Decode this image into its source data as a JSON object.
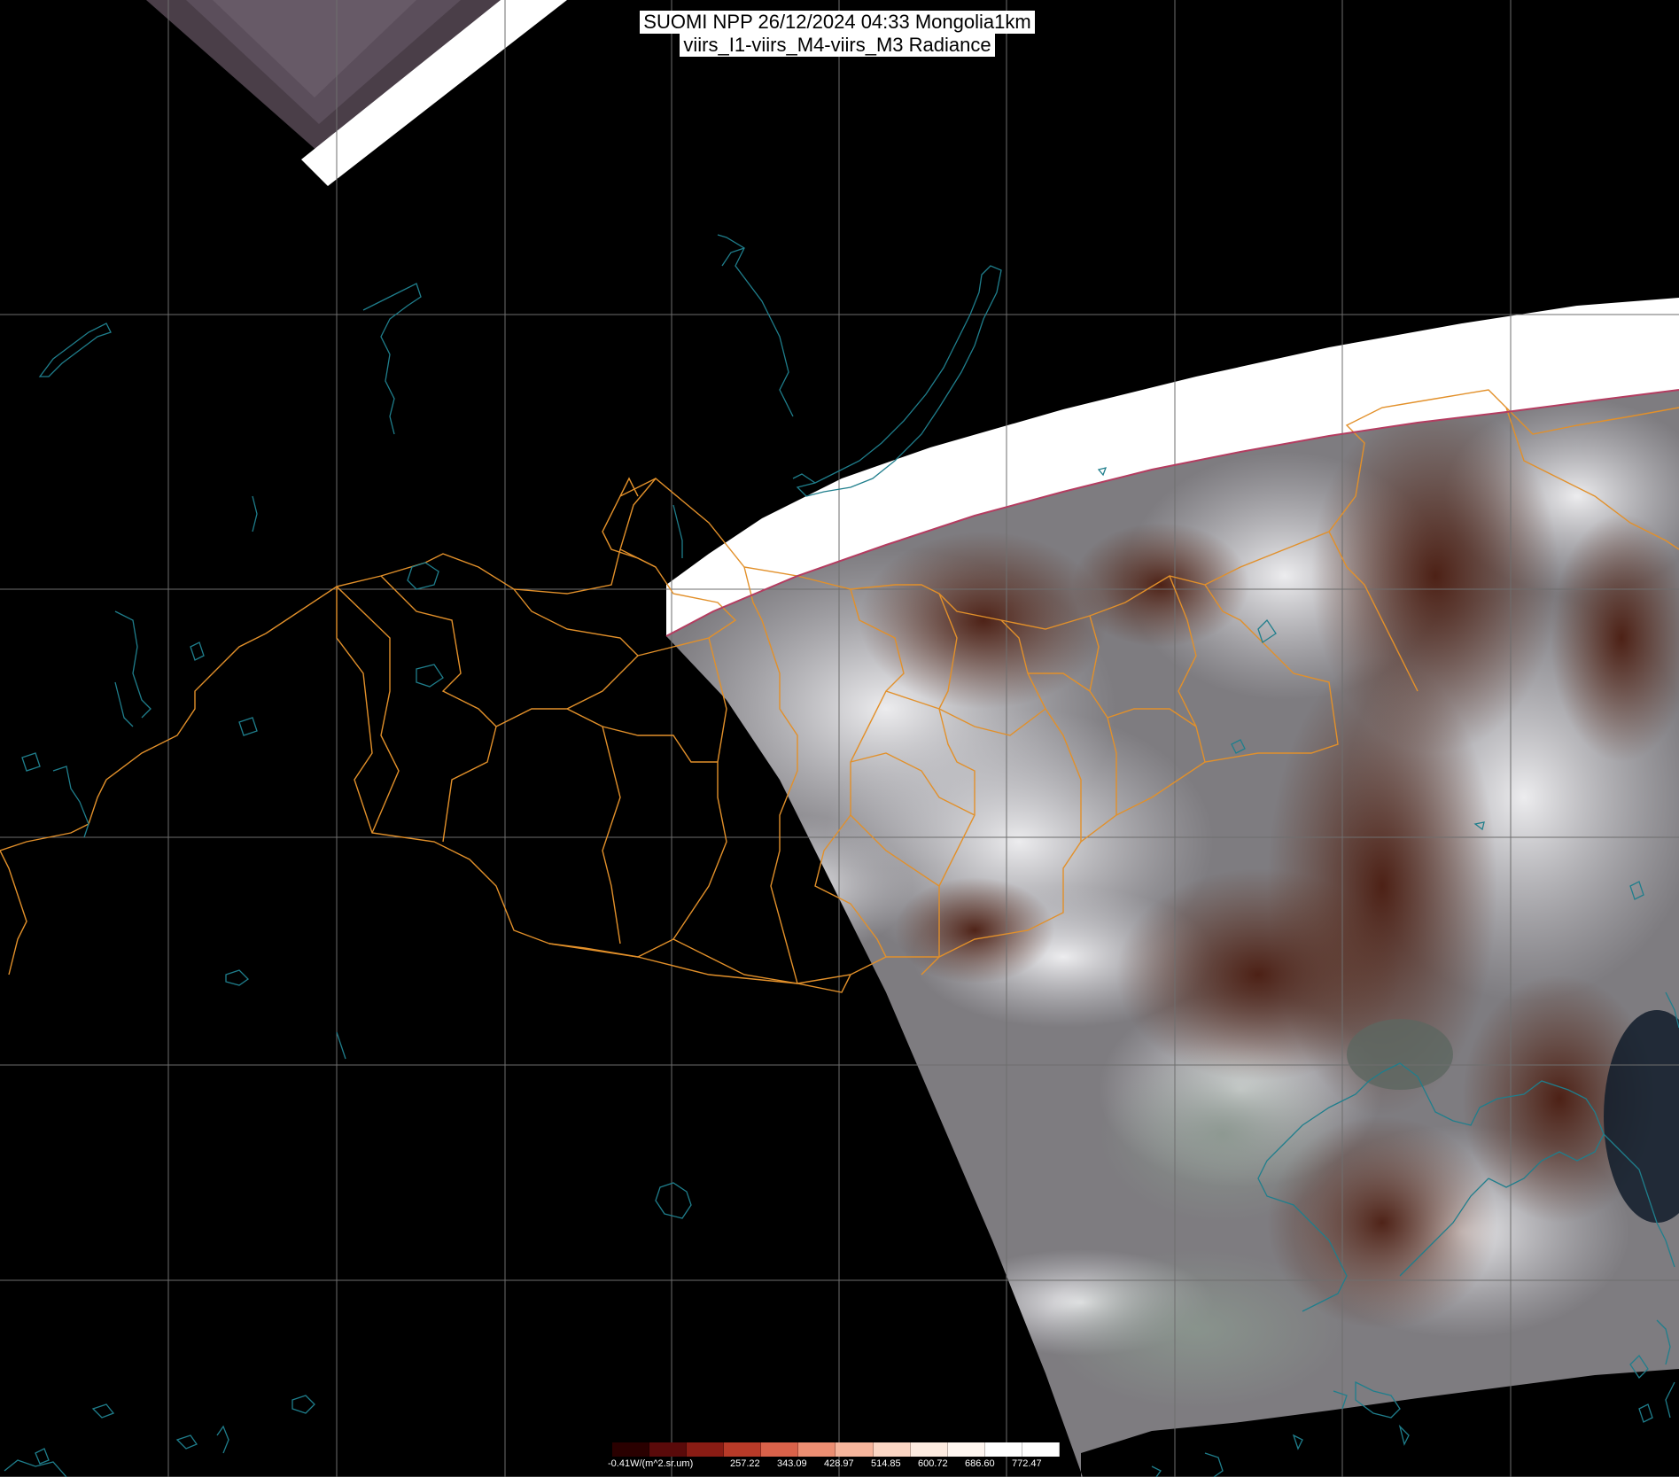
{
  "header": {
    "line1": "SUOMI NPP 26/12/2024 04:33 Mongolia1km",
    "line2": "viirs_I1-viirs_M4-viirs_M3 Radiance"
  },
  "legend": {
    "unit_label": "-0.41W/(m^2.sr.um)",
    "ticks": [
      "257.22",
      "343.09",
      "428.97",
      "514.85",
      "600.72",
      "686.60",
      "772.47"
    ],
    "colors": [
      "#2a0000",
      "#5a0a0a",
      "#8a1c14",
      "#b83a28",
      "#d9624a",
      "#ec8e72",
      "#f6b59c",
      "#fbd6c4",
      "#fdebe0",
      "#fff6f0",
      "#ffffff",
      "#ffffff"
    ]
  },
  "colors": {
    "grid": "#6e6e6e",
    "border": "#e2902a",
    "coast": "#1f7e8c",
    "swath_edge": "#ffffff"
  }
}
